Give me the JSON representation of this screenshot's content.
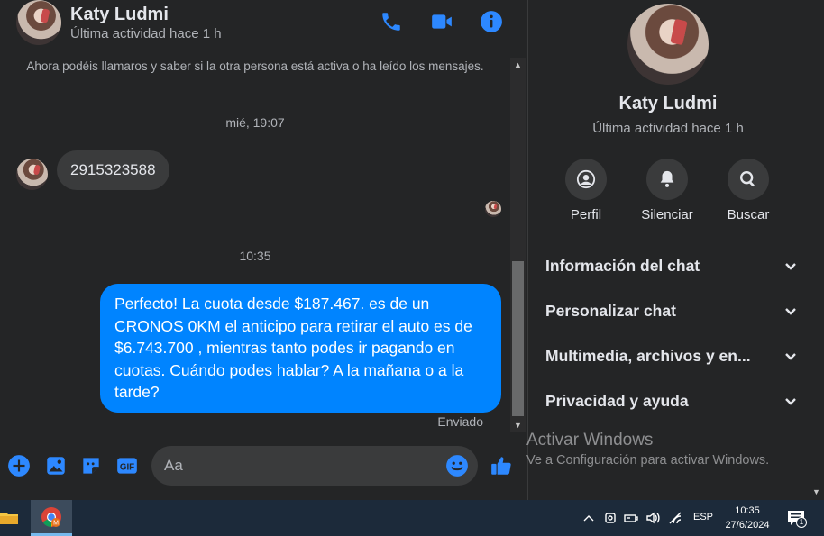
{
  "header": {
    "name": "Katy Ludmi",
    "status": "Última actividad hace 1 h"
  },
  "conversation": {
    "system_note": "Ahora podéis llamaros y saber si la otra persona está activa o ha leído los mensajes.",
    "timestamp_1": "mié, 19:07",
    "incoming_message": "2915323588",
    "timestamp_2": "10:35",
    "outgoing_message": "Perfecto! La cuota desde $187.467. es de un CRONOS 0KM el anticipo para retirar el auto es de $6.743.700 , mientras tanto podes ir pagando en cuotas. Cuándo podes hablar? A la mañana o a la tarde?",
    "delivery_status": "Enviado"
  },
  "composer": {
    "placeholder": "Aa"
  },
  "info_panel": {
    "name": "Katy Ludmi",
    "status": "Última actividad hace 1 h",
    "actions": [
      {
        "label": "Perfil",
        "icon": "profile-icon"
      },
      {
        "label": "Silenciar",
        "icon": "bell-icon"
      },
      {
        "label": "Buscar",
        "icon": "search-icon"
      }
    ],
    "sections": [
      {
        "label": "Información del chat"
      },
      {
        "label": "Personalizar chat"
      },
      {
        "label": "Multimedia, archivos y en..."
      },
      {
        "label": "Privacidad y ayuda"
      }
    ]
  },
  "watermark": {
    "title": "Activar Windows",
    "subtitle": "Ve a Configuración para activar Windows."
  },
  "taskbar": {
    "language": "ESP",
    "time": "10:35",
    "date": "27/6/2024",
    "notification_count": "1"
  },
  "colors": {
    "accent": "#0084ff",
    "icon_blue": "#2d88ff",
    "background": "#242526",
    "bubble_in": "#3a3b3c"
  }
}
